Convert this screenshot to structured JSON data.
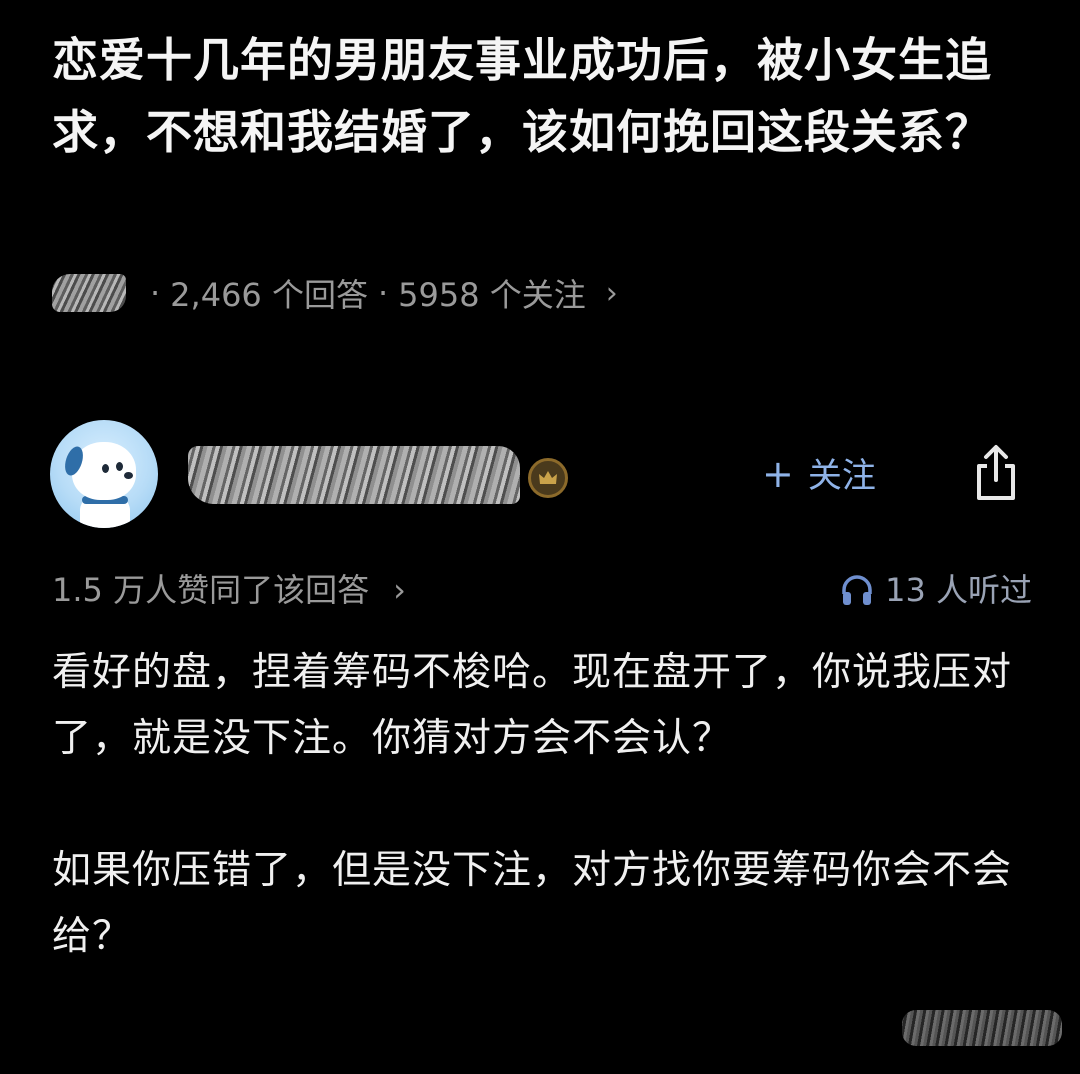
{
  "question": {
    "title": "恋爱十几年的男朋友事业成功后，被小女生追求，不想和我结婚了，该如何挽回这段关系？",
    "answer_count": "2,466 个回答",
    "follower_count": "5958 个关注",
    "chevron": "›",
    "separator": "·"
  },
  "answer": {
    "author": {
      "avatar_icon": "dog-avatar-icon",
      "badge_icon": "crown-icon"
    },
    "follow_label": "关注",
    "follow_plus": "+",
    "share_icon": "share-icon",
    "upvote_text": "1.5 万人赞同了该回答",
    "upvote_chevron": "›",
    "listen_icon": "headphones-icon",
    "listen_text": "13 人听过",
    "paragraphs": [
      "看好的盘，捏着筹码不梭哈。现在盘开了，你说我压对了，就是没下注。你猜对方会不会认？",
      "如果你压错了，但是没下注，对方找你要筹码你会不会给？"
    ]
  },
  "colors": {
    "background": "#000000",
    "primary_text": "#f2f2f2",
    "secondary_text": "#9a9a9a",
    "accent": "#8fb3e8"
  }
}
